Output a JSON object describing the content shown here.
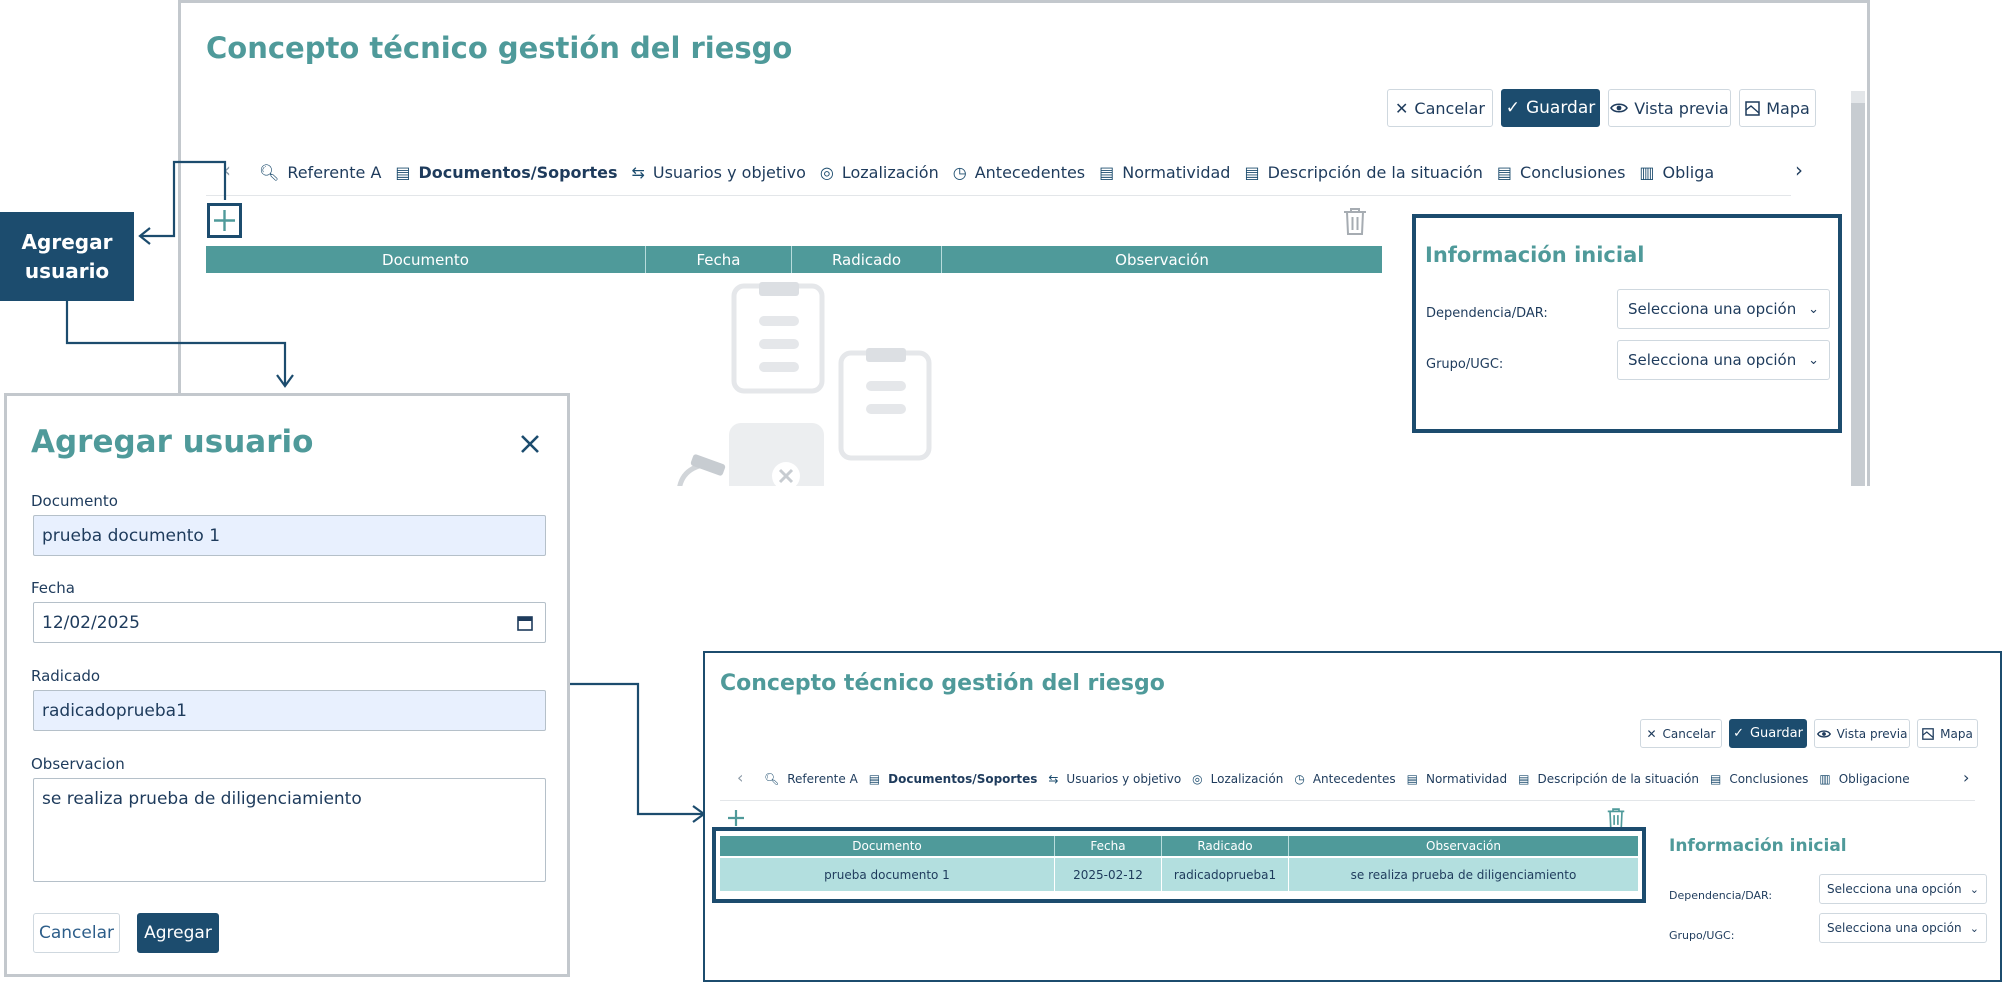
{
  "main": {
    "title": "Concepto técnico gestión del riesgo",
    "toolbar": {
      "cancel_label": "Cancelar",
      "save_label": "Guardar",
      "preview_label": "Vista previa",
      "map_label": "Mapa"
    },
    "tabs": [
      {
        "label": "Referente A",
        "icon": "search-document-icon"
      },
      {
        "label": "Documentos/Soportes",
        "icon": "document-icon"
      },
      {
        "label": "Usuarios y objetivo",
        "icon": "swap-arrows-icon"
      },
      {
        "label": "Lozalización",
        "icon": "target-icon"
      },
      {
        "label": "Antecedentes",
        "icon": "history-icon"
      },
      {
        "label": "Normatividad",
        "icon": "document-icon"
      },
      {
        "label": "Descripción de la situación",
        "icon": "document-icon"
      },
      {
        "label": "Conclusiones",
        "icon": "document-icon"
      },
      {
        "label": "Obligacione",
        "icon": "clipboard-icon"
      }
    ],
    "table_headers": [
      "Documento",
      "Fecha",
      "Radicado",
      "Observación"
    ],
    "info_panel": {
      "title": "Información inicial",
      "dependencia_label": "Dependencia/DAR:",
      "grupo_label": "Grupo/UGC:",
      "select_placeholder": "Selecciona una opción"
    }
  },
  "callout": {
    "line1": "Agregar",
    "line2": "usuario"
  },
  "modal": {
    "title": "Agregar usuario",
    "documento_label": "Documento",
    "documento_value": "prueba documento 1",
    "fecha_label": "Fecha",
    "fecha_value": "12/02/2025",
    "radicado_label": "Radicado",
    "radicado_value": "radicadoprueba1",
    "observacion_label": "Observacion",
    "observacion_value": "se realiza prueba de diligenciamiento",
    "cancel_label": "Cancelar",
    "add_label": "Agregar"
  },
  "result": {
    "title": "Concepto técnico gestión del riesgo",
    "toolbar": {
      "cancel_label": "Cancelar",
      "save_label": "Guardar",
      "preview_label": "Vista previa",
      "map_label": "Mapa"
    },
    "table_headers": [
      "Documento",
      "Fecha",
      "Radicado",
      "Observación"
    ],
    "row": [
      "prueba documento 1",
      "2025-02-12",
      "radicadoprueba1",
      "se realiza prueba de diligenciamiento"
    ],
    "info_panel": {
      "title": "Información inicial",
      "dependencia_label": "Dependencia/DAR:",
      "grupo_label": "Grupo/UGC:",
      "select_placeholder": "Selecciona una opción"
    }
  },
  "colors": {
    "teal": "#4f9a9a",
    "navy": "#1c4c6e",
    "row_highlight": "#b3dfdf"
  }
}
